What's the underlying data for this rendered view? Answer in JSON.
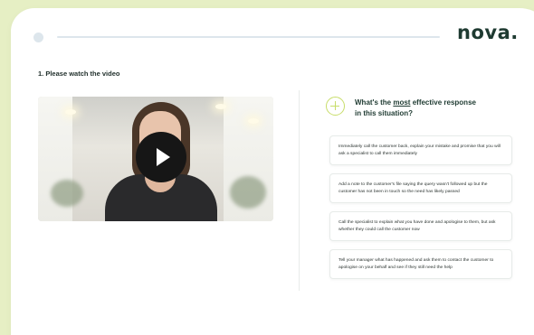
{
  "app": {
    "logo_text": "nova."
  },
  "progress": {
    "step": 1
  },
  "step": {
    "title": "1. Please watch the video"
  },
  "video": {
    "state": "paused",
    "play_icon": "play-icon"
  },
  "question": {
    "icon": "plus-circle-icon",
    "text_before": "What's the ",
    "text_emphasis": "most",
    "text_after": " effective response in this situation?"
  },
  "options": [
    {
      "text": "Immediately call the customer back, explain your mistake and promise that you will ask a specialist to call them immediately"
    },
    {
      "text": "Add a note to the customer's file saying the query wasn't followed up but the customer has not been in touch so the need has likely passed"
    },
    {
      "text": "Call the specialist to explain what you have done and apologise to them, but ask whether they could call the customer now"
    },
    {
      "text": "Tell your manager what has happened and ask them to contact the customer to apologise on your behalf and see if they still need the help"
    }
  ],
  "colors": {
    "background": "#e6efc4",
    "accent": "#c8dd6a",
    "brand_dark": "#1e3a31"
  }
}
